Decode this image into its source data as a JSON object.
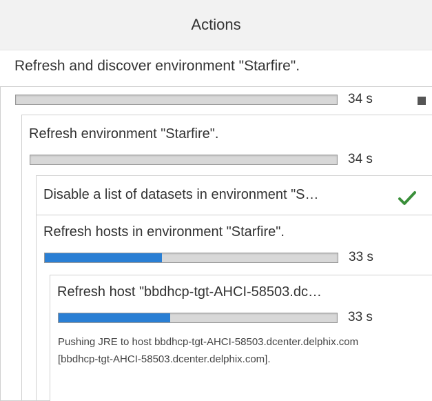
{
  "header": {
    "title": "Actions"
  },
  "root_action": {
    "title": "Refresh and discover environment \"Starfire\".",
    "elapsed": "34 s",
    "progress": 0
  },
  "child_action": {
    "title": "Refresh environment \"Starfire\".",
    "elapsed": "34 s",
    "progress": 0
  },
  "subtasks": [
    {
      "title": "Disable a list of datasets in environment \"S…",
      "status_icon": "checkmark-icon",
      "status_color": "#3a8f3a"
    },
    {
      "title": "Refresh hosts in environment \"Starfire\".",
      "elapsed": "33 s",
      "progress": 0.4
    }
  ],
  "host_task": {
    "title": "Refresh host \"bbdhcp-tgt-AHCI-58503.dc…",
    "elapsed": "33 s",
    "progress": 0.4,
    "message": "Pushing JRE to host bbdhcp-tgt-AHCI-58503.dcenter.delphix.com [bbdhcp-tgt-AHCI-58503.dcenter.delphix.com]."
  },
  "colors": {
    "progress_fill": "#2a7fd4",
    "header_bg": "#f2f2f2"
  }
}
